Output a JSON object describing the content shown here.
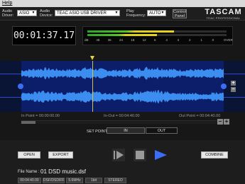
{
  "menu": {
    "help": "Help"
  },
  "settings": {
    "audio_driver_label": "Audio Driver:",
    "audio_driver_value": "ASIO",
    "audio_device_label": "Audio Device:",
    "audio_device_value": "TEAC ASIO USB DRIVER",
    "play_frequency_label": "Play Frequency:",
    "play_frequency_value": "AUTO",
    "control_panel_label": "Control Panel"
  },
  "brand": {
    "name": "TASCAM",
    "sub": "TEAC PROFESSIONAL"
  },
  "time": {
    "counter": "00:01:37.17"
  },
  "meter": {
    "left_level": 0.62,
    "right_level": 0.5,
    "scale": [
      "dB",
      "48",
      "36",
      "24",
      "18",
      "12",
      "6",
      "4",
      "3",
      "2",
      "1",
      "0",
      "OVER"
    ]
  },
  "waveform": {
    "playhead_fraction": 0.35
  },
  "points": {
    "in_point": "In Point = 00:00:00.00",
    "in_out": "In-Out = 00:04:40.00",
    "out_point": "Out Point = 00:04:40.00"
  },
  "set_point": {
    "label": "SET POINT",
    "in": "IN",
    "out": "OUT"
  },
  "buttons": {
    "open": "OPEN",
    "export": "EXPORT",
    "combine": "COMBINE"
  },
  "transport": {
    "play_pause": "play-pause-icon",
    "stop": "stop-icon",
    "play": "play-icon"
  },
  "file": {
    "name_label": "File Name :",
    "name_value": "01 DSD music.dsf",
    "duration": "00:04:40.00",
    "format": "DSF/DSDIFF",
    "rate": "5.6MHz",
    "bit": "1bit",
    "channels": "STEREO"
  },
  "colors": {
    "wave": "#3b8ef0",
    "meter_green": "#2ea32e",
    "meter_yellow": "#e8d41a",
    "play_blue": "#3b6ef5"
  }
}
